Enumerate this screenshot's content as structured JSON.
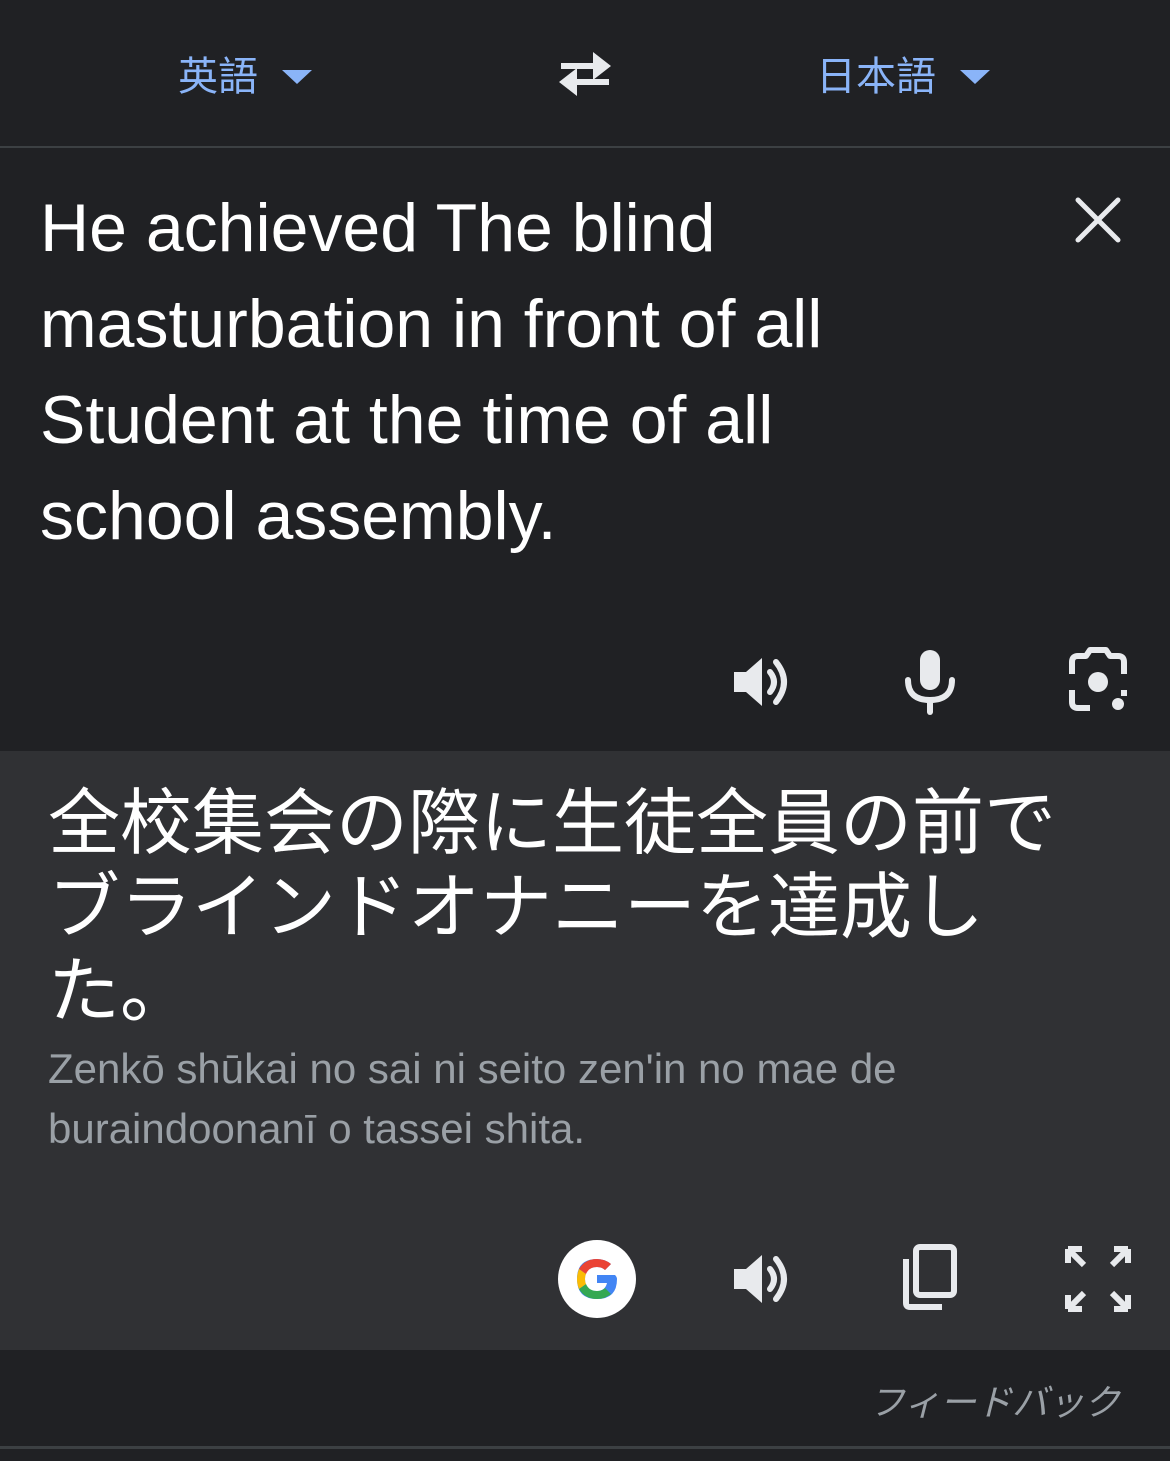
{
  "header": {
    "source_language": "英語",
    "target_language": "日本語",
    "icons": {
      "caret": "dropdown-caret-icon",
      "swap": "swap-arrows-icon"
    }
  },
  "source": {
    "text": "He achieved The blind\nmasturbation in front of all\nStudent at the time of all\nschool assembly.",
    "icons": [
      "close-icon",
      "speaker-icon",
      "microphone-icon",
      "camera-icon"
    ]
  },
  "result": {
    "text": "全校集会の際に生徒全員の前で\nブラインドオナニーを達成し\nた。",
    "romanization": "Zenkō shūkai no sai ni seito zen'in no mae de\nburaindoonanī o tassei shita.",
    "icons": [
      "google-logo-icon",
      "speaker-icon",
      "copy-icon",
      "fullscreen-icon"
    ]
  },
  "footer": {
    "feedback_label": "フィードバック"
  },
  "colors": {
    "background": "#202124",
    "result_background": "#303134",
    "accent": "#8ab4f8",
    "icon": "#e8eaed",
    "muted": "#9aa0a6"
  }
}
